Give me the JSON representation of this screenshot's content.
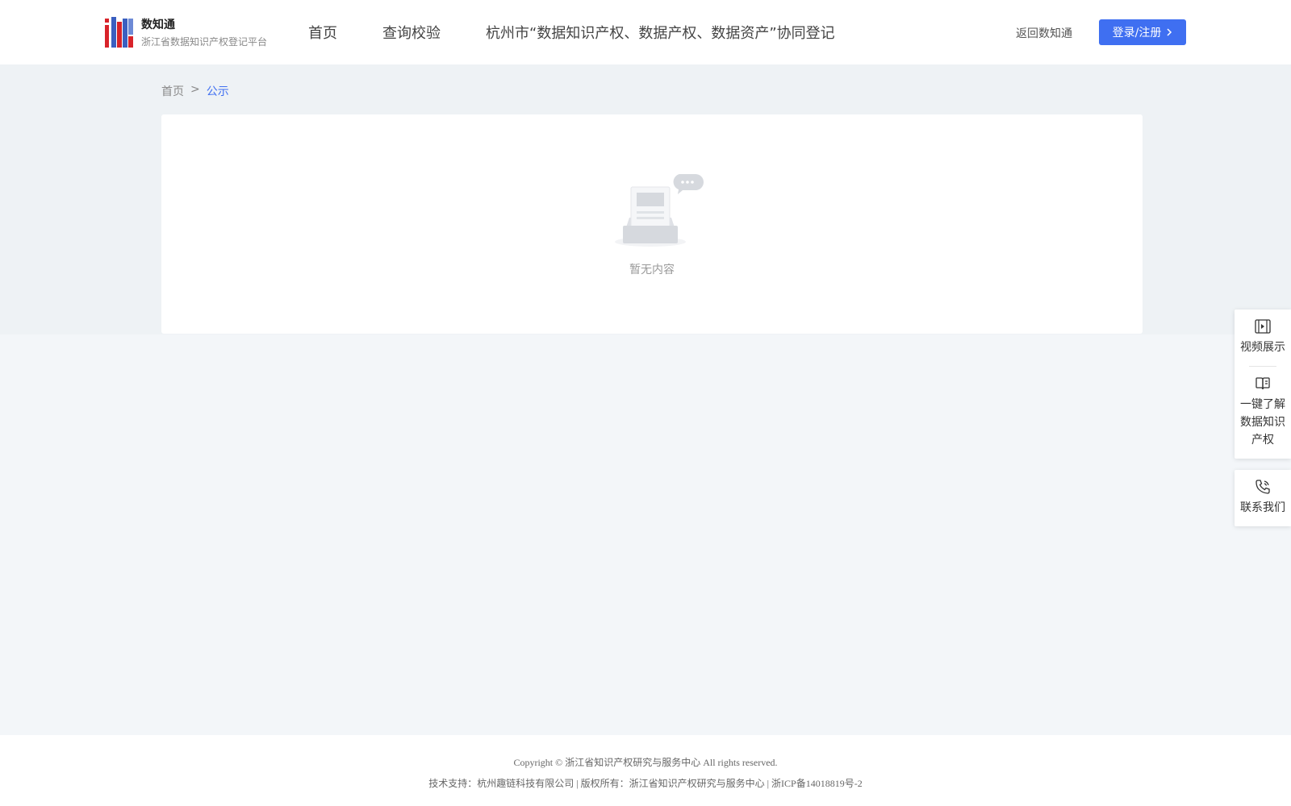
{
  "header": {
    "brand_name": "数知通",
    "brand_subtitle": "浙江省数据知识产权登记平台",
    "nav": [
      {
        "label": "首页"
      },
      {
        "label": "查询校验"
      },
      {
        "label": "杭州市“数据知识产权、数据产权、数据资产”协同登记"
      }
    ],
    "back_label": "返回数知通",
    "login_label": "登录/注册",
    "accent_color": "#3f6ff1"
  },
  "breadcrumb": {
    "home": "首页",
    "separator": ">",
    "current": "公示"
  },
  "content": {
    "empty_text": "暂无内容",
    "empty_icon": "empty-inbox-icon"
  },
  "side_tools": [
    {
      "label": "视频展示",
      "icon": "video-icon"
    },
    {
      "label": "一键了解数据知识产权",
      "icon": "book-icon"
    },
    {
      "label": "联系我们",
      "icon": "phone-icon"
    }
  ],
  "footer": {
    "copyright": "Copyright © 浙江省知识产权研究与服务中心 All rights reserved.",
    "support": "技术支持：杭州趣链科技有限公司 | 版权所有：浙江省知识产权研究与服务中心 | 浙ICP备14018819号-2"
  }
}
